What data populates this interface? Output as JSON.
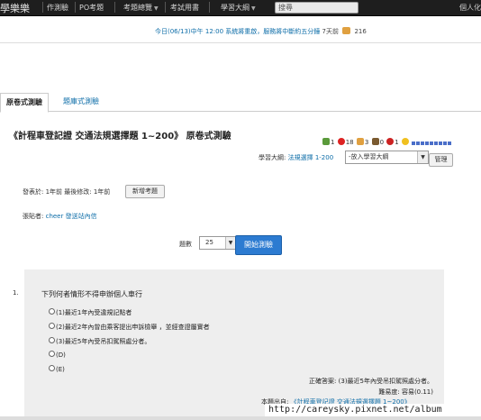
{
  "topnav": {
    "logo": "學樂樂",
    "items": [
      {
        "label": "作測驗"
      },
      {
        "label": "PO考題"
      },
      {
        "label": "考題總覽"
      },
      {
        "label": "考試用書"
      },
      {
        "label": "學習大綱"
      }
    ],
    "search_placeholder": "搜尋",
    "user": "個人化"
  },
  "notice": {
    "text": "今日(06/13)中午 12:00 系統將重啟，服務將中斷約五分鐘",
    "time": "7天前",
    "likes": "216"
  },
  "tabs": [
    {
      "label": "原卷式測驗"
    },
    {
      "label": "題庫式測驗"
    }
  ],
  "exam": {
    "title": "《計程車登記證 交通法規選擇題 1~200》 原卷式測驗",
    "stats": {
      "flags": "1",
      "hearts": "18",
      "thumbs": "3",
      "comments": "0",
      "reports": "1"
    },
    "outline_label": "學習大綱:",
    "outline_link": "法規選擇 1-200",
    "outline_select": "-放入學習大綱",
    "manage_button": "管理",
    "meta": "發表於: 1年前 最後修改: 1年前",
    "add_question_button": "新增考題",
    "poster_label": "張貼者:",
    "poster_name": "cheer",
    "poster_message": "發送站內信",
    "count_label": "題數",
    "count_value": "25",
    "start_button": "開始測驗"
  },
  "question": {
    "number": "1.",
    "text": "下列何者情形不得申辦個人車行",
    "options": [
      "(1)最近1年內受違規記點者",
      "(2)最近2年內曾由乘客提出申訴檢舉 ，並經查證屬實者",
      "(3)最近5年內受吊扣駕照處分者。",
      "(D)",
      "(E)"
    ],
    "answer": "正確答案: (3)最近5年內受吊扣駕照處分者。",
    "difficulty": "難易度: 容易(0.11)",
    "source_label": "本題出自:",
    "source_link": "《計程車登記證 交通法規選擇題 1~200》"
  },
  "watermark": "http://careysky.pixnet.net/album",
  "colors": {
    "nav_bg": "#1e1e1e",
    "link": "#0d6da8",
    "start_button": "#2c7bd1",
    "question_bg": "#eeeeee"
  }
}
